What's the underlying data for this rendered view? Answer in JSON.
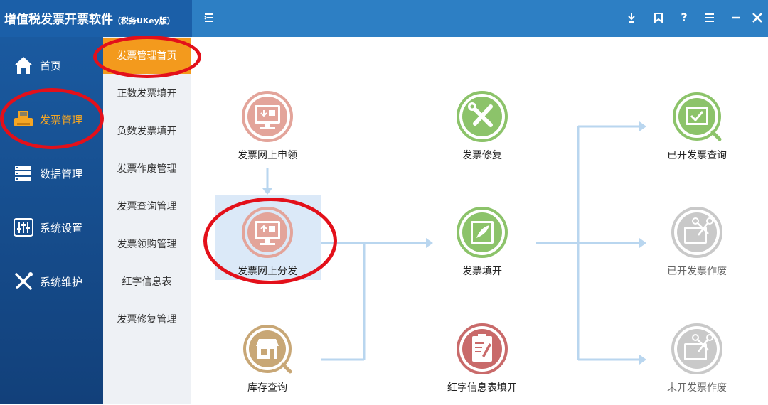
{
  "app": {
    "title": "增值税发票开票软件",
    "subtitle": "（税务UKey版）"
  },
  "toolbar": {
    "menu_icon": "menu-toggle-icon",
    "buttons": [
      "download-icon",
      "bookmark-icon",
      "help-icon",
      "list-icon",
      "minimize-icon",
      "close-icon"
    ],
    "help_label": "?"
  },
  "leftnav": {
    "items": [
      {
        "label": "首页",
        "icon": "home-icon"
      },
      {
        "label": "发票管理",
        "icon": "printer-icon",
        "active": true
      },
      {
        "label": "数据管理",
        "icon": "database-icon"
      },
      {
        "label": "系统设置",
        "icon": "sliders-icon"
      },
      {
        "label": "系统维护",
        "icon": "tools-icon"
      }
    ]
  },
  "subnav": {
    "items": [
      {
        "label": "发票管理首页",
        "active": true
      },
      {
        "label": "正数发票填开"
      },
      {
        "label": "负数发票填开"
      },
      {
        "label": "发票作废管理"
      },
      {
        "label": "发票查询管理"
      },
      {
        "label": "发票领购管理"
      },
      {
        "label": "红字信息表"
      },
      {
        "label": "发票修复管理"
      }
    ]
  },
  "flow": {
    "nodes": {
      "apply_online": {
        "label": "发票网上申领",
        "icon": "monitor-download-icon",
        "color": "#e3a49a"
      },
      "distribute_online": {
        "label": "发票网上分发",
        "icon": "monitor-upload-icon",
        "color": "#e3a49a"
      },
      "stock_query": {
        "label": "库存查询",
        "icon": "store-search-icon",
        "color": "#c8a776"
      },
      "repair": {
        "label": "发票修复",
        "icon": "wrench-screwdriver-icon",
        "color": "#8cc36a"
      },
      "fill": {
        "label": "发票填开",
        "icon": "invoice-pen-icon",
        "color": "#8cc36a"
      },
      "red_info_fill": {
        "label": "红字信息表填开",
        "icon": "clipboard-pen-icon",
        "color": "#c96a6a"
      },
      "issued_query": {
        "label": "已开发票查询",
        "icon": "invoice-check-search-icon",
        "color": "#8cc36a"
      },
      "issued_void": {
        "label": "已开发票作废",
        "icon": "invoice-scissors-icon",
        "color": "#c9c9c9"
      },
      "unissued_void": {
        "label": "未开发票作废",
        "icon": "invoice-scissors-icon",
        "color": "#c9c9c9"
      }
    },
    "arrow_color": "#b9d6ef",
    "highlight_color": "#e3101a"
  }
}
